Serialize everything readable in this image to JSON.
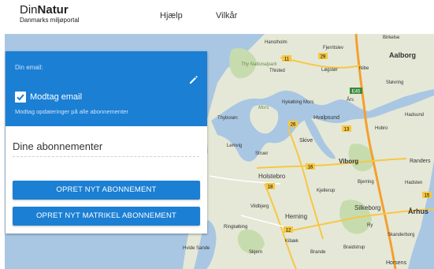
{
  "header": {
    "logo_part1": "Din",
    "logo_part2": "Natur",
    "logo_subtitle": "Danmarks miljøportal",
    "nav": [
      {
        "label": "Hjælp"
      },
      {
        "label": "Vilkår"
      }
    ]
  },
  "panel": {
    "email_label": "Din email:",
    "receive_email_label": "Modtag email",
    "receive_email_checked": true,
    "receive_email_description": "Modtag opdateringer på alle abonnementer",
    "subscriptions_title": "Dine abonnementer",
    "new_subscription_button": "OPRET NYT ABONNEMENT",
    "new_matrikel_button": "OPRET NYT MATRIKEL ABONNEMENT"
  },
  "map": {
    "places": [
      "Hanstholm",
      "Fjerritslev",
      "Birkelse",
      "Aalborg",
      "Thy Nationalpark",
      "Thisted",
      "Løgstør",
      "Nibe",
      "Støvring",
      "Års",
      "Nykøbing Mors",
      "Mors",
      "Thyborøn",
      "Hvalpsund",
      "Hobro",
      "Hadsund",
      "Lemvig",
      "Skive",
      "Struer",
      "Viborg",
      "Randers",
      "Holstebro",
      "Bjerring",
      "Hadsten",
      "Kjellerup",
      "Vildbjerg",
      "Herning",
      "Silkeborg",
      "Århus",
      "Ringkøbing",
      "Ry",
      "Skanderborg",
      "Kibæk",
      "Brande",
      "Hvide Sande",
      "Skjern",
      "Braidstrup",
      "Horsens"
    ],
    "road_shields": [
      "11",
      "29",
      "E45",
      "26",
      "13",
      "16",
      "18",
      "12",
      "15"
    ],
    "colors": {
      "water": "#a9c7e3",
      "land": "#e5e8d7",
      "forest": "#c7dcae",
      "road_major": "#f6c744",
      "road_minor": "#ffffff",
      "motorway": "#f59f2f"
    }
  },
  "colors": {
    "accent": "#1b7fd4"
  }
}
